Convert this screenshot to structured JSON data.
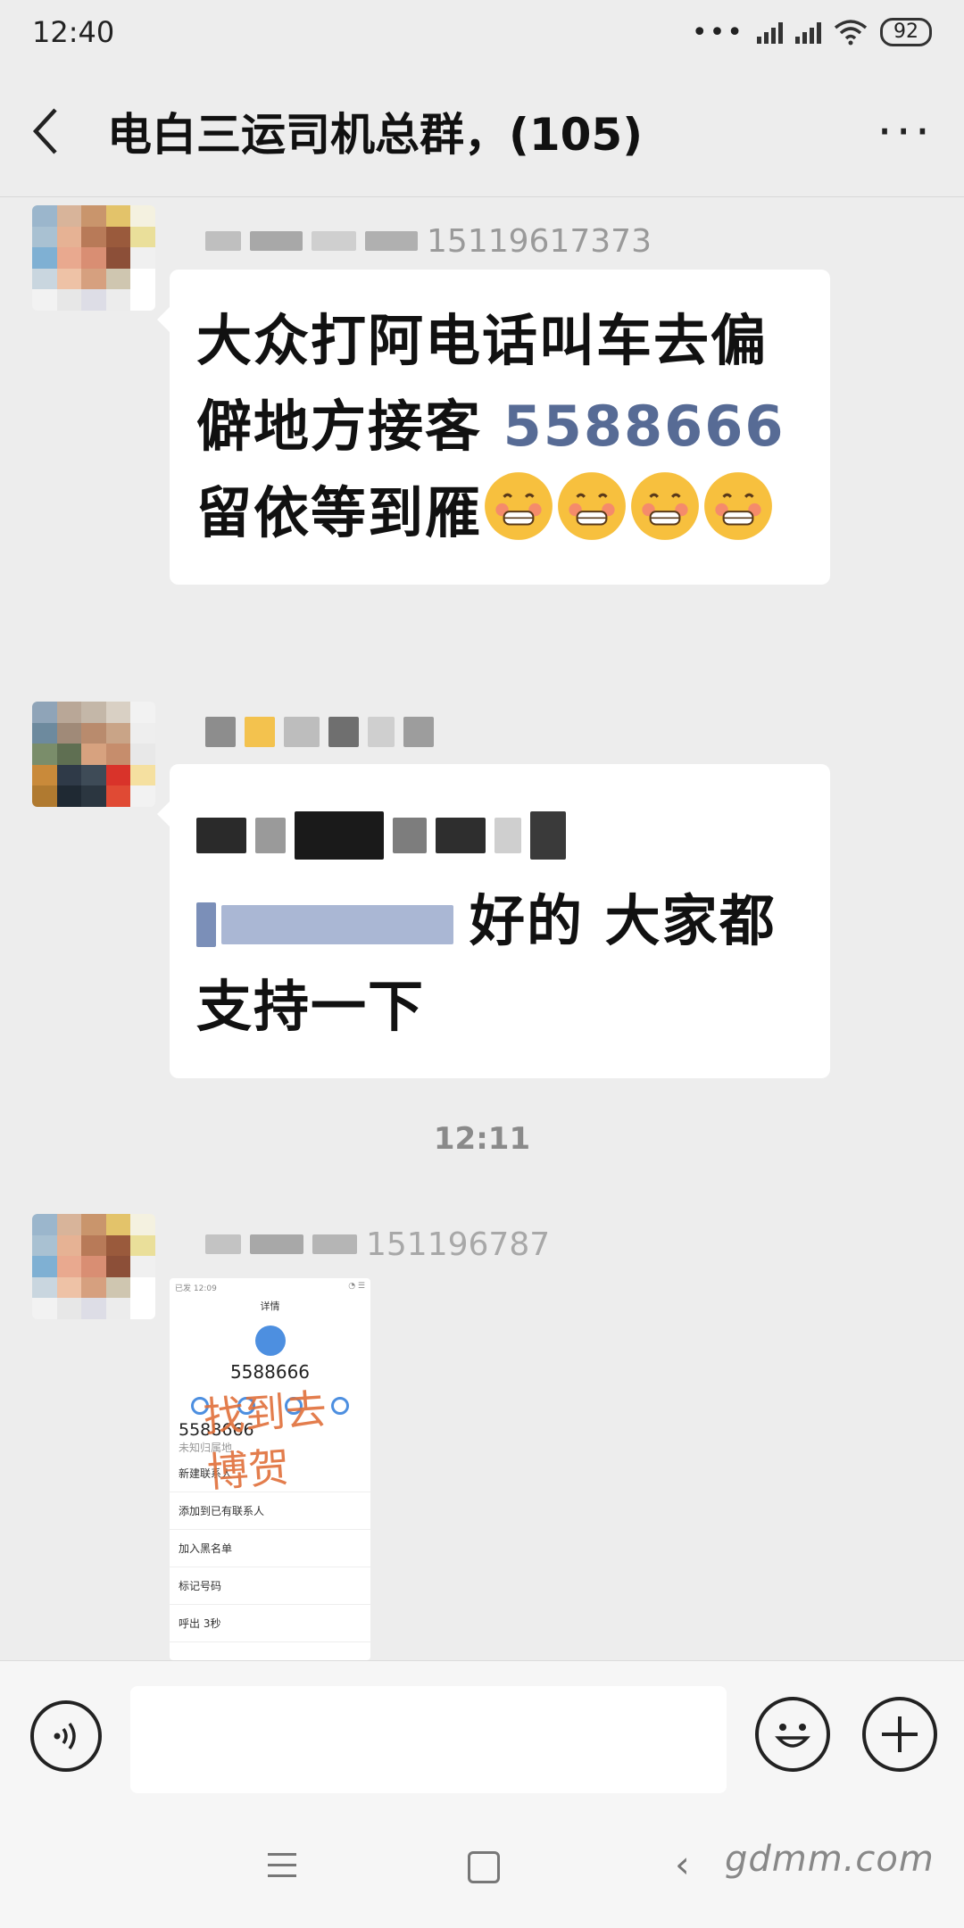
{
  "status_bar": {
    "time": "12:40",
    "battery": "92"
  },
  "header": {
    "title": "电白三运司机总群，(105)"
  },
  "messages": [
    {
      "sender_partial": "15119617373",
      "text_before": "大众打阿电话叫车去偏僻地方接客 ",
      "phone": "5588666",
      "text_after": " 留依等到雁"
    },
    {
      "text_tail": "好的 大家都支持一下"
    },
    {
      "sender_partial": "151196787",
      "thumbnail": {
        "status_left": "已发 12:09",
        "title": "详情",
        "number": "5588666",
        "number2": "5588666",
        "location": "未知归属地",
        "rows": [
          "新建联系人",
          "添加到已有联系人",
          "加入黑名单",
          "标记号码",
          "呼出 3秒"
        ],
        "scrawl": "找到去博贺"
      }
    }
  ],
  "time_separator": "12:11",
  "watermark": "gdmm.com",
  "colors": {
    "background": "#ededed",
    "link": "#576b95",
    "bubble": "#ffffff"
  }
}
